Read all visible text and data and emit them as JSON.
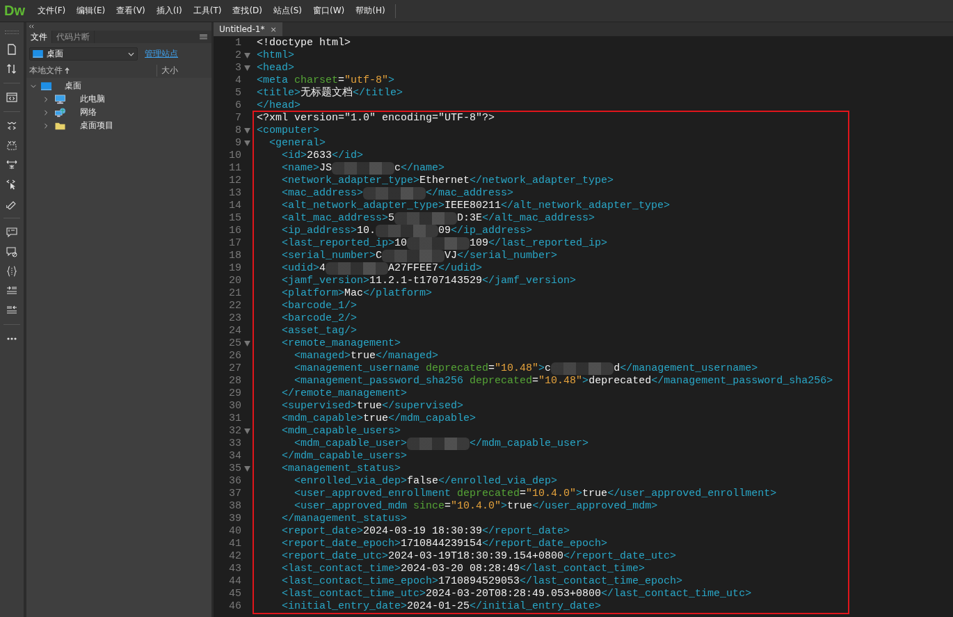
{
  "app": {
    "logo": "Dw"
  },
  "menu": [
    "文件(F)",
    "编辑(E)",
    "查看(V)",
    "插入(I)",
    "工具(T)",
    "查找(D)",
    "站点(S)",
    "窗口(W)",
    "帮助(H)"
  ],
  "files_panel": {
    "tabs": [
      {
        "label": "文件",
        "selected": true
      },
      {
        "label": "代码片断",
        "selected": false
      }
    ],
    "site_select": {
      "value": "桌面"
    },
    "manage_link": "管理站点",
    "columns": [
      "本地文件",
      "大小"
    ],
    "tree": [
      {
        "label": "桌面",
        "expanded": true,
        "children": [
          {
            "label": "此电脑",
            "expanded": false
          },
          {
            "label": "网络",
            "expanded": false
          },
          {
            "label": "桌面项目",
            "expanded": false
          }
        ]
      }
    ]
  },
  "editor": {
    "tabs": [
      {
        "label": "Untitled-1*",
        "close": "×",
        "selected": true
      }
    ],
    "lines": [
      {
        "n": "1",
        "fold": false,
        "tokens": [
          {
            "kind": "plain",
            "text": "<!doctype html>"
          }
        ]
      },
      {
        "n": "2",
        "fold": true,
        "tokens": [
          {
            "kind": "tag",
            "text": "<html>"
          }
        ]
      },
      {
        "n": "3",
        "fold": true,
        "tokens": [
          {
            "kind": "tag",
            "text": "<head>"
          }
        ]
      },
      {
        "n": "4",
        "fold": false,
        "tokens": [
          {
            "kind": "tag",
            "text": "<meta "
          },
          {
            "kind": "attr",
            "text": "charset"
          },
          {
            "kind": "plain",
            "text": "="
          },
          {
            "kind": "value",
            "text": "\"utf-8\""
          },
          {
            "kind": "tag",
            "text": ">"
          }
        ]
      },
      {
        "n": "5",
        "fold": false,
        "tokens": [
          {
            "kind": "tag",
            "text": "<title>"
          },
          {
            "kind": "plain",
            "text": "无标题文档"
          },
          {
            "kind": "tag",
            "text": "</title>"
          }
        ]
      },
      {
        "n": "6",
        "fold": false,
        "tokens": [
          {
            "kind": "tag",
            "text": "</head>"
          }
        ]
      }
    ],
    "highlight_block": {
      "lines": [
        {
          "n": "7",
          "fold": false,
          "tokens": [
            {
              "kind": "plain",
              "text": "<?xml version=\"1.0\" encoding=\"UTF-8\"?>"
            }
          ]
        },
        {
          "n": "8",
          "fold": true,
          "tokens": [
            {
              "kind": "tag",
              "text": "<computer>"
            }
          ]
        },
        {
          "n": "9",
          "fold": true,
          "tokens": [
            {
              "kind": "tag",
              "text": "  <general>"
            }
          ]
        },
        {
          "n": "10",
          "fold": false,
          "tokens": [
            {
              "kind": "tag",
              "text": "    <id>"
            },
            {
              "kind": "plain",
              "text": "2633"
            },
            {
              "kind": "tag",
              "text": "</id>"
            }
          ]
        },
        {
          "n": "11",
          "fold": false,
          "tokens": [
            {
              "kind": "tag",
              "text": "    <name>"
            },
            {
              "kind": "plain",
              "text": "JS"
            },
            {
              "kind": "redacted"
            },
            {
              "kind": "plain",
              "text": "c"
            },
            {
              "kind": "tag",
              "text": "</name>"
            }
          ]
        },
        {
          "n": "12",
          "fold": false,
          "tokens": [
            {
              "kind": "tag",
              "text": "    <network_adapter_type>"
            },
            {
              "kind": "plain",
              "text": "Ethernet"
            },
            {
              "kind": "tag",
              "text": "</network_adapter_type>"
            }
          ]
        },
        {
          "n": "13",
          "fold": false,
          "tokens": [
            {
              "kind": "tag",
              "text": "    <mac_address>"
            },
            {
              "kind": "redacted"
            },
            {
              "kind": "tag",
              "text": "</mac_address>"
            }
          ]
        },
        {
          "n": "14",
          "fold": false,
          "tokens": [
            {
              "kind": "tag",
              "text": "    <alt_network_adapter_type>"
            },
            {
              "kind": "plain",
              "text": "IEEE80211"
            },
            {
              "kind": "tag",
              "text": "</alt_network_adapter_type>"
            }
          ]
        },
        {
          "n": "15",
          "fold": false,
          "tokens": [
            {
              "kind": "tag",
              "text": "    <alt_mac_address>"
            },
            {
              "kind": "plain",
              "text": "5"
            },
            {
              "kind": "redacted"
            },
            {
              "kind": "plain",
              "text": "D:3E"
            },
            {
              "kind": "tag",
              "text": "</alt_mac_address>"
            }
          ]
        },
        {
          "n": "16",
          "fold": false,
          "tokens": [
            {
              "kind": "tag",
              "text": "    <ip_address>"
            },
            {
              "kind": "plain",
              "text": "10."
            },
            {
              "kind": "redacted"
            },
            {
              "kind": "plain",
              "text": "09"
            },
            {
              "kind": "tag",
              "text": "</ip_address>"
            }
          ]
        },
        {
          "n": "17",
          "fold": false,
          "tokens": [
            {
              "kind": "tag",
              "text": "    <last_reported_ip>"
            },
            {
              "kind": "plain",
              "text": "10"
            },
            {
              "kind": "redacted"
            },
            {
              "kind": "plain",
              "text": "109"
            },
            {
              "kind": "tag",
              "text": "</last_reported_ip>"
            }
          ]
        },
        {
          "n": "18",
          "fold": false,
          "tokens": [
            {
              "kind": "tag",
              "text": "    <serial_number>"
            },
            {
              "kind": "plain",
              "text": "C"
            },
            {
              "kind": "redacted"
            },
            {
              "kind": "plain",
              "text": "VJ"
            },
            {
              "kind": "tag",
              "text": "</serial_number>"
            }
          ]
        },
        {
          "n": "19",
          "fold": false,
          "tokens": [
            {
              "kind": "tag",
              "text": "    <udid>"
            },
            {
              "kind": "plain",
              "text": "4"
            },
            {
              "kind": "redacted"
            },
            {
              "kind": "plain",
              "text": "A27FFEE7"
            },
            {
              "kind": "tag",
              "text": "</udid>"
            }
          ]
        },
        {
          "n": "20",
          "fold": false,
          "tokens": [
            {
              "kind": "tag",
              "text": "    <jamf_version>"
            },
            {
              "kind": "plain",
              "text": "11.2.1-t1707143529"
            },
            {
              "kind": "tag",
              "text": "</jamf_version>"
            }
          ]
        },
        {
          "n": "21",
          "fold": false,
          "tokens": [
            {
              "kind": "tag",
              "text": "    <platform>"
            },
            {
              "kind": "plain",
              "text": "Mac"
            },
            {
              "kind": "tag",
              "text": "</platform>"
            }
          ]
        },
        {
          "n": "22",
          "fold": false,
          "tokens": [
            {
              "kind": "tag",
              "text": "    <barcode_1/>"
            }
          ]
        },
        {
          "n": "23",
          "fold": false,
          "tokens": [
            {
              "kind": "tag",
              "text": "    <barcode_2/>"
            }
          ]
        },
        {
          "n": "24",
          "fold": false,
          "tokens": [
            {
              "kind": "tag",
              "text": "    <asset_tag/>"
            }
          ]
        },
        {
          "n": "25",
          "fold": true,
          "tokens": [
            {
              "kind": "tag",
              "text": "    <remote_management>"
            }
          ]
        },
        {
          "n": "26",
          "fold": false,
          "tokens": [
            {
              "kind": "tag",
              "text": "      <managed>"
            },
            {
              "kind": "plain",
              "text": "true"
            },
            {
              "kind": "tag",
              "text": "</managed>"
            }
          ]
        },
        {
          "n": "27",
          "fold": false,
          "tokens": [
            {
              "kind": "tag",
              "text": "      <management_username "
            },
            {
              "kind": "attr",
              "text": "deprecated"
            },
            {
              "kind": "plain",
              "text": "="
            },
            {
              "kind": "value",
              "text": "\"10.48\""
            },
            {
              "kind": "tag",
              "text": ">"
            },
            {
              "kind": "plain",
              "text": "c"
            },
            {
              "kind": "redacted"
            },
            {
              "kind": "plain",
              "text": "d"
            },
            {
              "kind": "tag",
              "text": "</management_username>"
            }
          ]
        },
        {
          "n": "28",
          "fold": false,
          "tokens": [
            {
              "kind": "tag",
              "text": "      <management_password_sha256 "
            },
            {
              "kind": "attr",
              "text": "deprecated"
            },
            {
              "kind": "plain",
              "text": "="
            },
            {
              "kind": "value",
              "text": "\"10.48\""
            },
            {
              "kind": "tag",
              "text": ">"
            },
            {
              "kind": "plain",
              "text": "deprecated"
            },
            {
              "kind": "tag",
              "text": "</management_password_sha256>"
            }
          ]
        },
        {
          "n": "29",
          "fold": false,
          "tokens": [
            {
              "kind": "tag",
              "text": "    </remote_management>"
            }
          ]
        },
        {
          "n": "30",
          "fold": false,
          "tokens": [
            {
              "kind": "tag",
              "text": "    <supervised>"
            },
            {
              "kind": "plain",
              "text": "true"
            },
            {
              "kind": "tag",
              "text": "</supervised>"
            }
          ]
        },
        {
          "n": "31",
          "fold": false,
          "tokens": [
            {
              "kind": "tag",
              "text": "    <mdm_capable>"
            },
            {
              "kind": "plain",
              "text": "true"
            },
            {
              "kind": "tag",
              "text": "</mdm_capable>"
            }
          ]
        },
        {
          "n": "32",
          "fold": true,
          "tokens": [
            {
              "kind": "tag",
              "text": "    <mdm_capable_users>"
            }
          ]
        },
        {
          "n": "33",
          "fold": false,
          "tokens": [
            {
              "kind": "tag",
              "text": "      <mdm_capable_user>"
            },
            {
              "kind": "redacted"
            },
            {
              "kind": "tag",
              "text": "</mdm_capable_user>"
            }
          ]
        },
        {
          "n": "34",
          "fold": false,
          "tokens": [
            {
              "kind": "tag",
              "text": "    </mdm_capable_users>"
            }
          ]
        },
        {
          "n": "35",
          "fold": true,
          "tokens": [
            {
              "kind": "tag",
              "text": "    <management_status>"
            }
          ]
        },
        {
          "n": "36",
          "fold": false,
          "tokens": [
            {
              "kind": "tag",
              "text": "      <enrolled_via_dep>"
            },
            {
              "kind": "plain",
              "text": "false"
            },
            {
              "kind": "tag",
              "text": "</enrolled_via_dep>"
            }
          ]
        },
        {
          "n": "37",
          "fold": false,
          "tokens": [
            {
              "kind": "tag",
              "text": "      <user_approved_enrollment "
            },
            {
              "kind": "attr",
              "text": "deprecated"
            },
            {
              "kind": "plain",
              "text": "="
            },
            {
              "kind": "value",
              "text": "\"10.4.0\""
            },
            {
              "kind": "tag",
              "text": ">"
            },
            {
              "kind": "plain",
              "text": "true"
            },
            {
              "kind": "tag",
              "text": "</user_approved_enrollment>"
            }
          ]
        },
        {
          "n": "38",
          "fold": false,
          "tokens": [
            {
              "kind": "tag",
              "text": "      <user_approved_mdm "
            },
            {
              "kind": "attr",
              "text": "since"
            },
            {
              "kind": "plain",
              "text": "="
            },
            {
              "kind": "value",
              "text": "\"10.4.0\""
            },
            {
              "kind": "tag",
              "text": ">"
            },
            {
              "kind": "plain",
              "text": "true"
            },
            {
              "kind": "tag",
              "text": "</user_approved_mdm>"
            }
          ]
        },
        {
          "n": "39",
          "fold": false,
          "tokens": [
            {
              "kind": "tag",
              "text": "    </management_status>"
            }
          ]
        },
        {
          "n": "40",
          "fold": false,
          "tokens": [
            {
              "kind": "tag",
              "text": "    <report_date>"
            },
            {
              "kind": "plain",
              "text": "2024-03-19 18:30:39"
            },
            {
              "kind": "tag",
              "text": "</report_date>"
            }
          ]
        },
        {
          "n": "41",
          "fold": false,
          "tokens": [
            {
              "kind": "tag",
              "text": "    <report_date_epoch>"
            },
            {
              "kind": "plain",
              "text": "1710844239154"
            },
            {
              "kind": "tag",
              "text": "</report_date_epoch>"
            }
          ]
        },
        {
          "n": "42",
          "fold": false,
          "tokens": [
            {
              "kind": "tag",
              "text": "    <report_date_utc>"
            },
            {
              "kind": "plain",
              "text": "2024-03-19T18:30:39.154+0800"
            },
            {
              "kind": "tag",
              "text": "</report_date_utc>"
            }
          ]
        },
        {
          "n": "43",
          "fold": false,
          "tokens": [
            {
              "kind": "tag",
              "text": "    <last_contact_time>"
            },
            {
              "kind": "plain",
              "text": "2024-03-20 08:28:49"
            },
            {
              "kind": "tag",
              "text": "</last_contact_time>"
            }
          ]
        },
        {
          "n": "44",
          "fold": false,
          "tokens": [
            {
              "kind": "tag",
              "text": "    <last_contact_time_epoch>"
            },
            {
              "kind": "plain",
              "text": "1710894529053"
            },
            {
              "kind": "tag",
              "text": "</last_contact_time_epoch>"
            }
          ]
        },
        {
          "n": "45",
          "fold": false,
          "tokens": [
            {
              "kind": "tag",
              "text": "    <last_contact_time_utc>"
            },
            {
              "kind": "plain",
              "text": "2024-03-20T08:28:49.053+0800"
            },
            {
              "kind": "tag",
              "text": "</last_contact_time_utc>"
            }
          ]
        },
        {
          "n": "46",
          "fold": false,
          "tokens": [
            {
              "kind": "tag",
              "text": "    <initial_entry_date>"
            },
            {
              "kind": "plain",
              "text": "2024-01-25"
            },
            {
              "kind": "tag",
              "text": "</initial_entry_date>"
            }
          ]
        }
      ]
    }
  }
}
